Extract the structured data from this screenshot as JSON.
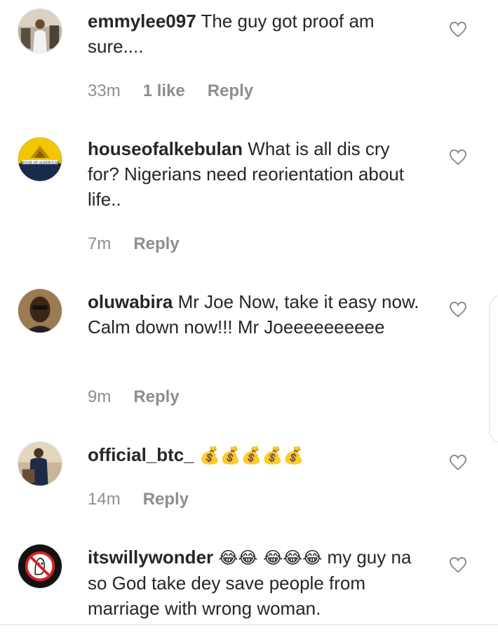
{
  "comments": [
    {
      "username": "emmylee097",
      "text": "The guy got proof am sure....",
      "time": "33m",
      "likes": "1 like",
      "reply": "Reply",
      "avatar_icon": "person-photo"
    },
    {
      "username": "houseofalkebulan",
      "text": "What is all dis cry for? Nigerians need reorientation about life..",
      "time": "7m",
      "likes": "",
      "reply": "Reply",
      "avatar_icon": "pyramid-logo"
    },
    {
      "username": "oluwabira",
      "text": "Mr Joe Now, take it easy now. Calm down now!!! Mr Joeeeeeeeeee",
      "time": "9m",
      "likes": "",
      "reply": "Reply",
      "avatar_icon": "person-photo"
    },
    {
      "username": "official_btc_",
      "text": "💰💰💰💰💰",
      "time": "14m",
      "likes": "",
      "reply": "Reply",
      "avatar_icon": "person-photo"
    },
    {
      "username": "itswillywonder",
      "text_emoji": "😂😂 😂😂😂",
      "text": "my guy na so God take dey save people from marriage with wrong woman.",
      "time": "",
      "likes": "",
      "reply": "",
      "avatar_icon": "ghostbusters-logo"
    }
  ],
  "colors": {
    "text": "#262626",
    "meta": "#8e8e8e",
    "divider": "#dbdbdb"
  },
  "icons": {
    "like": "heart-outline-icon"
  }
}
